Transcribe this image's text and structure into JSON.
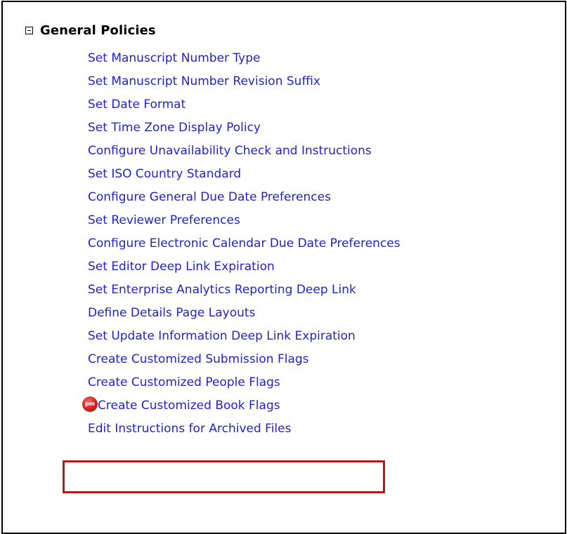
{
  "section": {
    "title": "General Policies",
    "toggle_icon": "collapse-minus-icon"
  },
  "links": [
    "Set Manuscript Number Type",
    "Set Manuscript Number Revision Suffix",
    "Set Date Format",
    "Set Time Zone Display Policy",
    "Configure Unavailability Check and Instructions",
    "Set ISO Country Standard",
    "Configure General Due Date Preferences",
    "Set Reviewer Preferences",
    "Configure Electronic Calendar Due Date Preferences",
    "Set Editor Deep Link Expiration",
    "Set Enterprise Analytics Reporting Deep Link",
    "Define Details Page Layouts",
    "Set Update Information Deep Link Expiration",
    "Create Customized Submission Flags",
    "Create Customized People Flags",
    "Create Customized Book Flags",
    "Edit Instructions for Archived Files"
  ],
  "highlighted_link": {
    "badge_text": "pm",
    "badge_icon": "pm-badge-icon",
    "highlight_color": "#b31b1b"
  },
  "colors": {
    "link": "#2222cc",
    "heading": "#000000",
    "border": "#000000"
  }
}
